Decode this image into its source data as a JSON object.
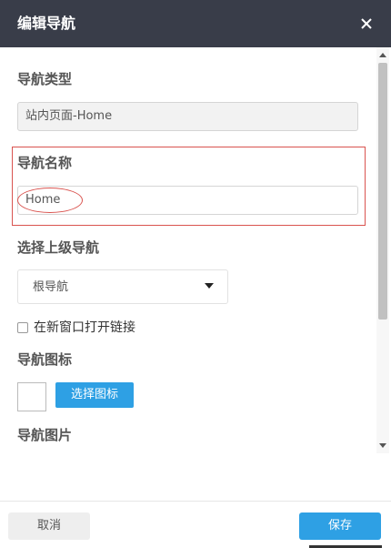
{
  "dialog": {
    "title": "编辑导航",
    "close_icon": "close-icon"
  },
  "form": {
    "nav_type_label": "导航类型",
    "nav_type_value": "站内页面-Home",
    "nav_name_label": "导航名称",
    "nav_name_value": "Home",
    "parent_nav_label": "选择上级导航",
    "parent_nav_value": "根导航",
    "open_new_window_label": "在新窗口打开链接",
    "open_new_window_checked": false,
    "nav_icon_label": "导航图标",
    "choose_icon_label": "选择图标",
    "nav_image_label": "导航图片"
  },
  "footer": {
    "cancel_label": "取消",
    "save_label": "保存"
  },
  "colors": {
    "header_bg": "#393d49",
    "primary": "#2ea0e4",
    "highlight": "#d9534f"
  }
}
